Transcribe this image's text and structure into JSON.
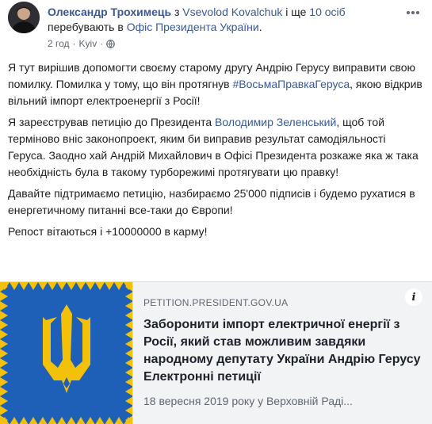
{
  "post": {
    "author": "Олександр Трохимець",
    "header_with": " з ",
    "tagged_person": "Vsevolod Kovalchuk",
    "header_and": " і ще ",
    "others_count": "10 осіб",
    "header_location_prefix": " перебувають в ",
    "location": "Офіс Президента України",
    "header_end": ".",
    "time": "2 год",
    "sep": "·",
    "place": "Kyiv",
    "sep2": "·"
  },
  "body": {
    "p1_a": "Я тут вирішив допомогти своєму старому другу Андрію Герусу виправити свою помилку. Помилка у тому, що він протягнув ",
    "p1_hashtag": "#ВосьмаПравкаГеруса",
    "p1_b": ", якою відкрив вільний імпорт електроенергії з Росії!",
    "p2_a": "Я зареєстрував петицію до Президента ",
    "p2_mention": "Володимир Зеленський",
    "p2_b": ", щоб той терміново вніс законопроект, яким би виправив результат самодіяльності Геруса. Заодно хай Андрій Михайлович в Офісі Президента розкаже яка ж така необхідність була в такому турборежимі протягувати цю правку!",
    "p3": "Давайте підтримаємо петицію, назбираємо 25'000 підписів і будемо рухатися в енергетичному питанні все-таки до Європи!",
    "p4": "Репост вітаються і +10000000 в карму!"
  },
  "card": {
    "domain": "PETITION.PRESIDENT.GOV.UA",
    "title": "Заборонити імпорт електричної енергії з Росії, який став можливим завдяки народному депутату України Андрію Герусу Електронні петиції",
    "description": "18 вересня 2019 року у Верховній Раді...",
    "info_label": "i"
  },
  "colors": {
    "link": "#385898",
    "flag_blue": "#1e5fb8",
    "flag_gold": "#f3c10a",
    "card_bg": "#f2f3f5"
  },
  "icons": {
    "more": "more-options-icon",
    "globe": "globe-icon",
    "info": "info-icon"
  }
}
